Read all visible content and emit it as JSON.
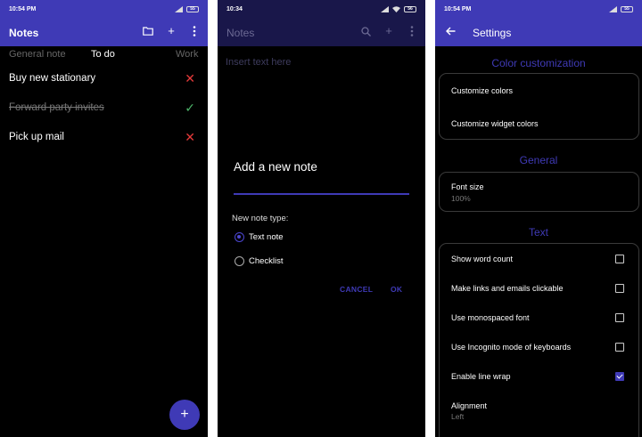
{
  "phone1": {
    "status_time": "10:54 PM",
    "battery": "55",
    "title": "Notes",
    "tabs": [
      "General note",
      "To do",
      "Work"
    ],
    "notes": [
      {
        "text": "Buy new stationary",
        "done": false
      },
      {
        "text": "Forward party invites",
        "done": true
      },
      {
        "text": "Pick up mail",
        "done": false
      }
    ],
    "fab_label": "+"
  },
  "phone2": {
    "status_time": "10:34",
    "battery": "56",
    "title": "Notes",
    "placeholder": "Insert text here",
    "dialog": {
      "title": "Add a new note",
      "type_label": "New note type:",
      "options": [
        "Text note",
        "Checklist"
      ],
      "selected": "Text note",
      "cancel": "CANCEL",
      "ok": "OK"
    }
  },
  "phone3": {
    "status_time": "10:54 PM",
    "battery": "55",
    "title": "Settings",
    "sections": {
      "color": {
        "title": "Color customization",
        "items": [
          "Customize colors",
          "Customize widget colors"
        ]
      },
      "general": {
        "title": "General",
        "font_size_label": "Font size",
        "font_size_value": "100%"
      },
      "text": {
        "title": "Text",
        "toggles": [
          {
            "label": "Show word count",
            "checked": false
          },
          {
            "label": "Make links and emails clickable",
            "checked": false
          },
          {
            "label": "Use monospaced font",
            "checked": false
          },
          {
            "label": "Use Incognito mode of keyboards",
            "checked": false
          },
          {
            "label": "Enable line wrap",
            "checked": true
          }
        ],
        "alignment_label": "Alignment",
        "alignment_value": "Left"
      }
    }
  },
  "colors": {
    "accent": "#3f3ab6",
    "delete": "#e53a3a",
    "done": "#4db56a"
  }
}
